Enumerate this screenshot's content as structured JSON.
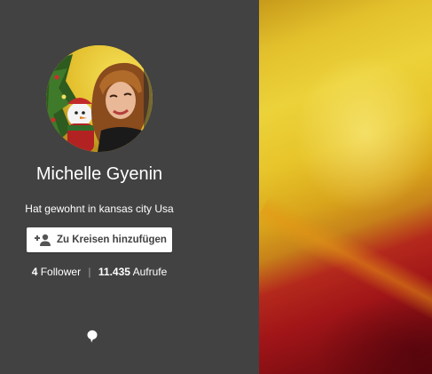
{
  "profile": {
    "name": "Michelle Gyenin",
    "location": "Hat gewohnt in kansas city Usa",
    "add_button_label": "Zu Kreisen hinzufügen",
    "followers_count": "4",
    "followers_label": "Follower",
    "views_count": "11.435",
    "views_label": "Aufrufe",
    "separator": "|"
  },
  "icons": {
    "add_button": "person-add-icon",
    "bottom": "speech-bubble-icon"
  },
  "colors": {
    "panel_background": "#424242",
    "text": "#ffffff",
    "button_background": "#ffffff",
    "button_text": "#424242"
  }
}
